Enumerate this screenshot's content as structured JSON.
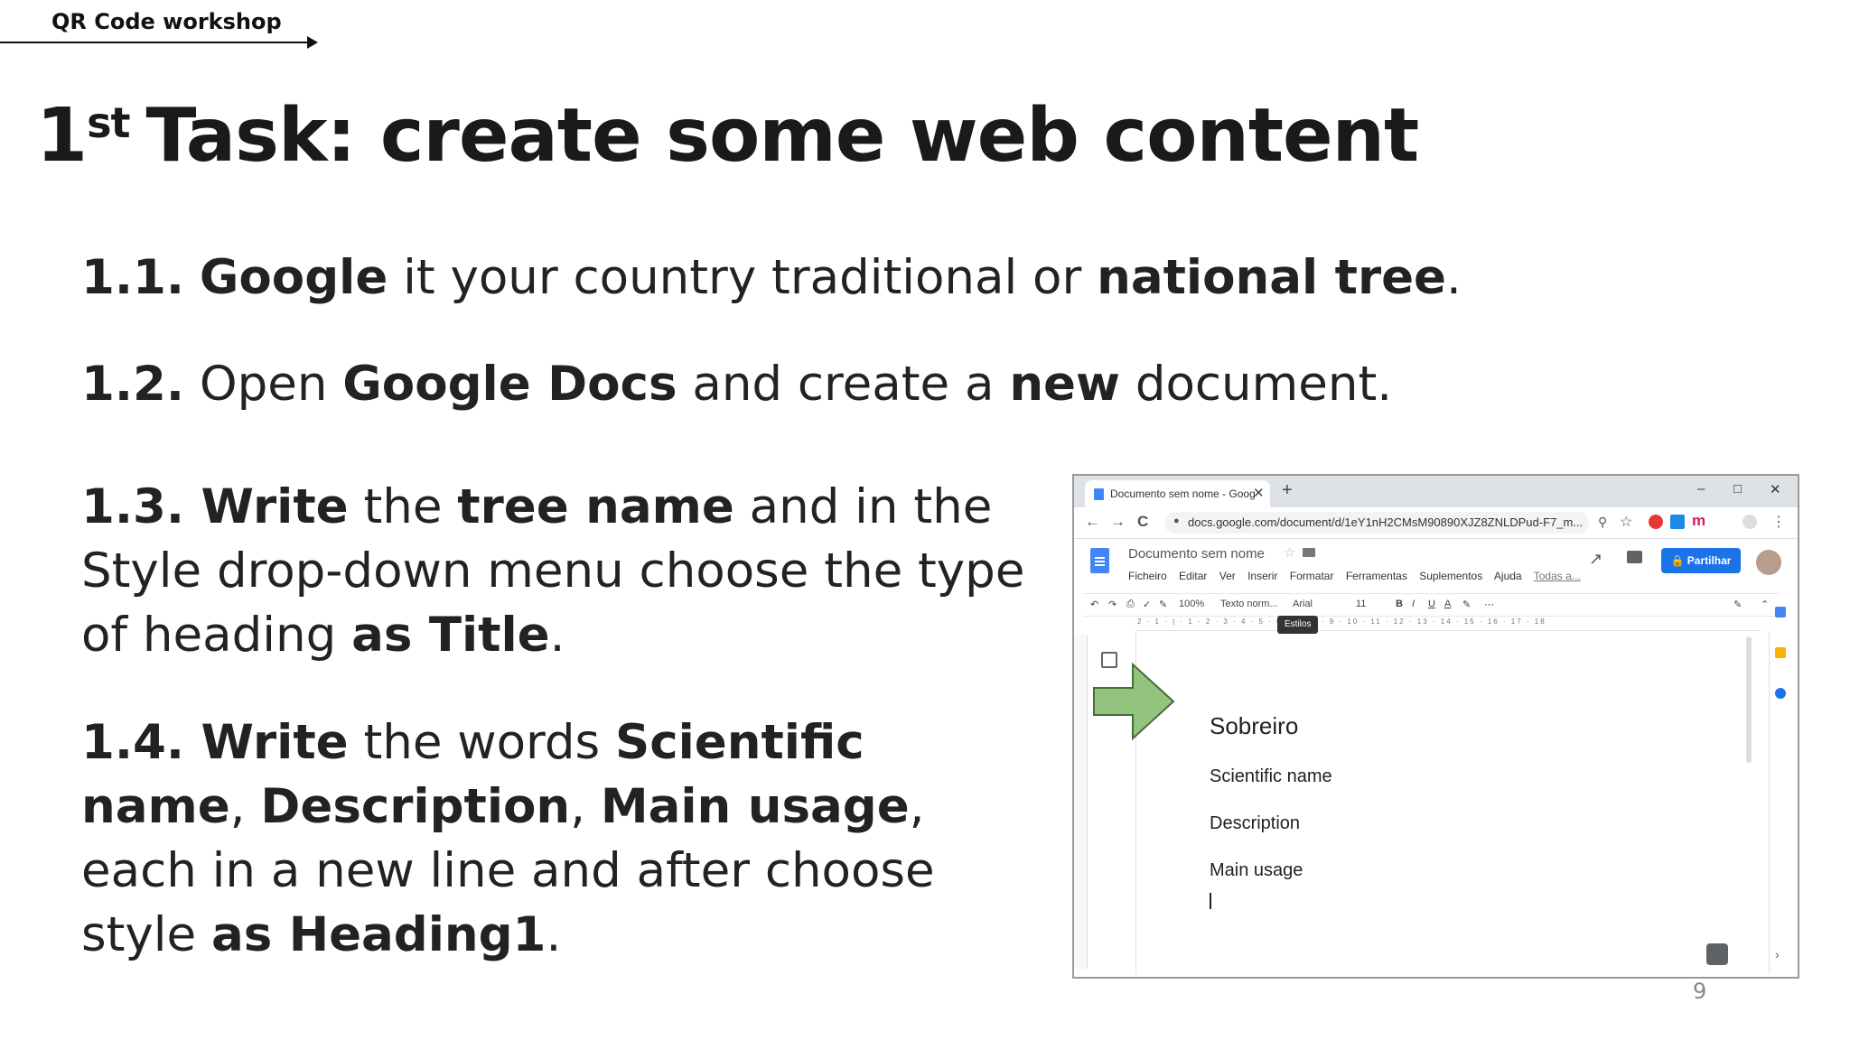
{
  "header": {
    "title": "QR Code workshop"
  },
  "slide": {
    "title_num": "1",
    "title_sup": "st",
    "title_rest": "Task: create some web content",
    "page_number": "9"
  },
  "steps": {
    "s1": {
      "num": "1.1.",
      "google": "Google",
      "t1": " it your country traditional or ",
      "b1": "national tree",
      "t2": "."
    },
    "s2": {
      "num": "1.2.",
      "t1": " Open ",
      "b1": "Google Docs",
      "t2": " and create a ",
      "b2": "new",
      "t3": " document."
    },
    "s3": {
      "num": "1.3.",
      "b0": " Write",
      "t1": " the ",
      "b1": "tree name",
      "t2": " and in the Style drop-down menu choose the type of heading ",
      "b2": "as Title",
      "t3": "."
    },
    "s4": {
      "num": "1.4.",
      "b0": " Write",
      "t1": " the words ",
      "b1": "Scientific name",
      "t2": ", ",
      "b2": "Description",
      "t3": ", ",
      "b3": "Main usage",
      "t4": ", each in a new line and after choose style ",
      "b4": "as Heading1",
      "t5": "."
    }
  },
  "screenshot": {
    "tab_title": "Documento sem nome - Google",
    "tab_close": "✕",
    "new_tab": "+",
    "win_min": "–",
    "win_max": "□",
    "win_close": "✕",
    "nav_back": "←",
    "nav_fwd": "→",
    "nav_reload": "C",
    "url": "docs.google.com/document/d/1eY1nH2CMsM90890XJZ8ZNLDPud-F7_m...",
    "doc_name": "Documento sem nome",
    "menus": [
      "Ficheiro",
      "Editar",
      "Ver",
      "Inserir",
      "Formatar",
      "Ferramentas",
      "Suplementos",
      "Ajuda"
    ],
    "menu_last": "Todas a...",
    "share_label": "🔒 Partilhar",
    "toolbar": {
      "zoom": "100%",
      "style": "Texto norm...",
      "font": "Arial",
      "size": "11"
    },
    "tooltip": "Estilos",
    "ruler": "2 · 1 · | · 1 · 2 · 3 · 4 · 5 · 6 · 7 · 8 · 9 · 10 · 11 · 12 · 13 · 14 · 15 · 16 · 17 · 18",
    "doc_title": "Sobreiro",
    "doc_lines": [
      "Scientific name",
      "Description",
      "Main usage"
    ],
    "colors": {
      "share": "#1a73e8",
      "docs_blue": "#4285f4",
      "arrow_green": "#93c47d"
    }
  }
}
